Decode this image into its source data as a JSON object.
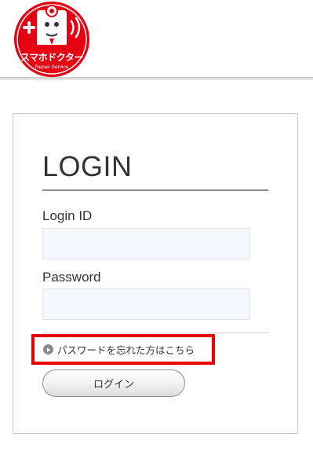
{
  "header": {
    "logo_text": "スマホドクター",
    "logo_subtext": "Repair Service"
  },
  "login": {
    "title": "LOGIN",
    "login_id_label": "Login ID",
    "login_id_value": "",
    "password_label": "Password",
    "password_value": "",
    "forgot_link": "パスワードを忘れた方はこちら",
    "submit_label": "ログイン"
  },
  "colors": {
    "brand_red": "#e60012",
    "highlight_border": "#e60000",
    "input_bg": "#f5f8fe"
  },
  "icons": {
    "logo": "smartphone-doctor-logo-icon",
    "forgot": "play-circle-icon"
  }
}
